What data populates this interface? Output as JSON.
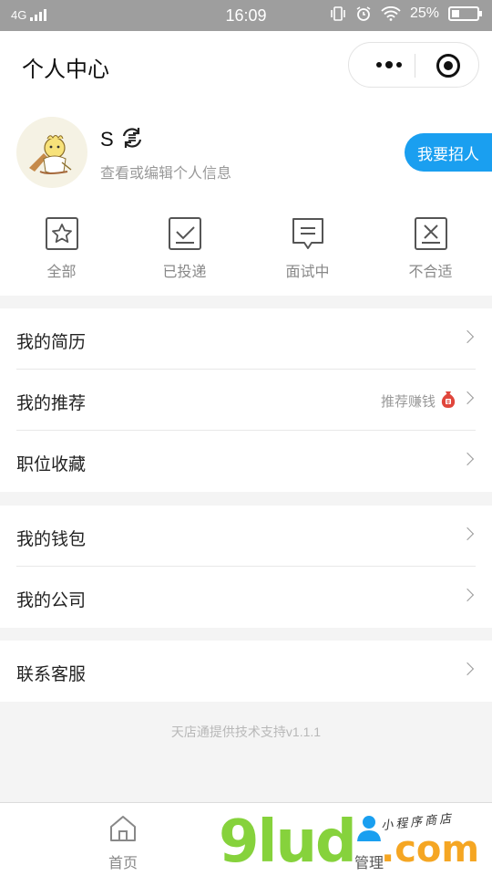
{
  "status_bar": {
    "network": "4G",
    "time": "16:09",
    "battery": "25%"
  },
  "header": {
    "title": "个人中心",
    "more_icon": "more-dots-icon",
    "close_icon": "target-icon"
  },
  "profile": {
    "username": "S",
    "edit_hint": "查看或编辑个人信息",
    "recruit_button": "我要招人"
  },
  "stats": [
    {
      "label": "全部",
      "icon": "star-icon"
    },
    {
      "label": "已投递",
      "icon": "check-box-icon"
    },
    {
      "label": "面试中",
      "icon": "chat-bubble-icon"
    },
    {
      "label": "不合适",
      "icon": "x-box-icon"
    }
  ],
  "menu": {
    "group1": [
      {
        "label": "我的简历"
      },
      {
        "label": "我的推荐",
        "extra": "推荐赚钱"
      },
      {
        "label": "职位收藏"
      }
    ],
    "group2": [
      {
        "label": "我的钱包"
      },
      {
        "label": "我的公司"
      }
    ],
    "group3": [
      {
        "label": "联系客服"
      }
    ]
  },
  "footer_note": "天店通提供技术支持v1.1.1",
  "tabbar": {
    "home": "首页",
    "manage": "管理"
  },
  "watermark": {
    "main": "9lud",
    "com": ".com",
    "sub": "小程序商店"
  },
  "colors": {
    "accent": "#1a9ff0",
    "status_bar": "#9e9e9e",
    "background": "#f4f4f4"
  }
}
